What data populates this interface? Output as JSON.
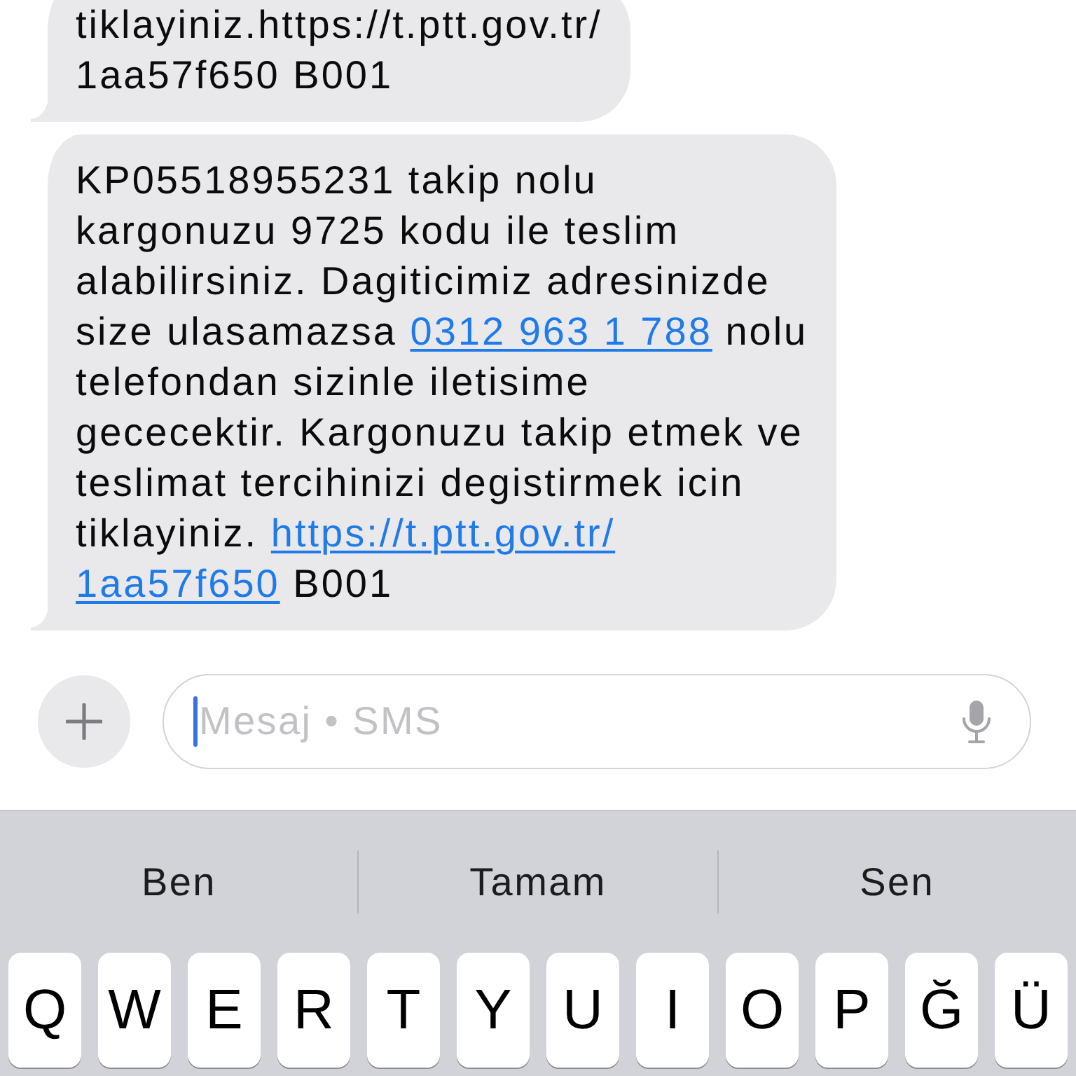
{
  "messages": [
    {
      "segments": [
        {
          "kind": "text",
          "lines": [
            "tiklayiniz.https://t.ptt.gov.tr/",
            "1aa57f650 B001"
          ]
        }
      ]
    },
    {
      "segments": [
        {
          "kind": "text",
          "lines": [
            "KP05518955231 takip nolu",
            "kargonuzu 9725 kodu ile teslim",
            "alabilirsiniz. Dagiticimiz adresinizde",
            "size ulasamazsa"
          ]
        },
        {
          "kind": "phone",
          "lines": [
            "0312 963 1 788"
          ]
        },
        {
          "kind": "text",
          "lines": [
            "nolu",
            "telefondan sizinle iletisime",
            "gececektir. Kargonuzu takip etmek ve",
            "teslimat tercihinizi degistirmek icin",
            "tiklayiniz."
          ]
        },
        {
          "kind": "link",
          "lines": [
            "https://t.ptt.gov.tr/",
            "1aa57f650"
          ]
        },
        {
          "kind": "text",
          "lines": [
            "B001"
          ]
        }
      ]
    }
  ],
  "composer": {
    "placeholder": "Mesaj • SMS"
  },
  "suggestions": [
    "Ben",
    "Tamam",
    "Sen"
  ],
  "keys": [
    "Q",
    "W",
    "E",
    "R",
    "T",
    "Y",
    "U",
    "I",
    "O",
    "P",
    "Ğ",
    "Ü"
  ]
}
